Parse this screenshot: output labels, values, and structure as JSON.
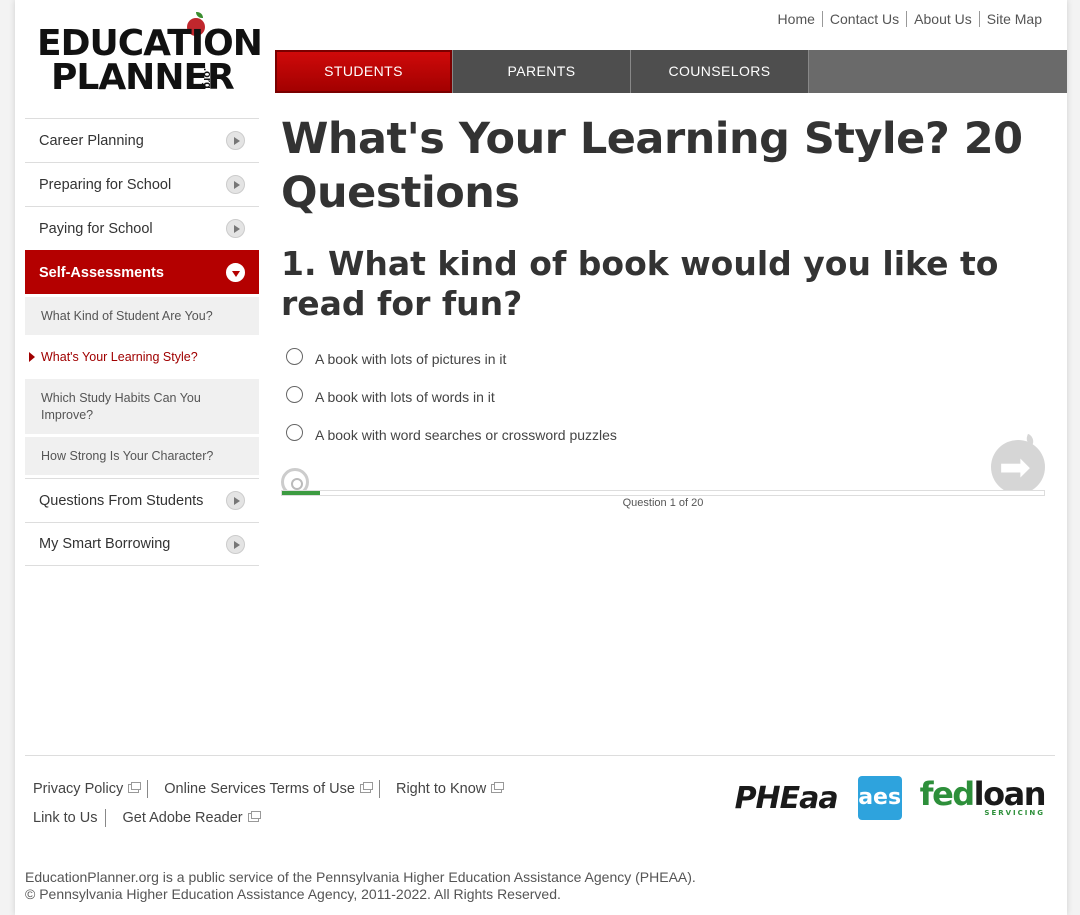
{
  "logo": {
    "line1": "EDUCATION",
    "line2": "PLANNER",
    "suffix": ".org"
  },
  "toplinks": [
    "Home",
    "Contact Us",
    "About Us",
    "Site Map"
  ],
  "tabs": [
    "STUDENTS",
    "PARENTS",
    "COUNSELORS"
  ],
  "sidebar": {
    "items": [
      {
        "label": "Career Planning"
      },
      {
        "label": "Preparing for School"
      },
      {
        "label": "Paying for School"
      },
      {
        "label": "Self-Assessments"
      },
      {
        "label": "Questions From Students"
      },
      {
        "label": "My Smart Borrowing"
      }
    ],
    "subitems": [
      {
        "label": "What Kind of Student Are You?"
      },
      {
        "label": "What's Your Learning Style?"
      },
      {
        "label": "Which Study Habits Can You Improve?"
      },
      {
        "label": "How Strong Is Your Character?"
      }
    ]
  },
  "main": {
    "title": "What's Your Learning Style? 20 Questions",
    "question": "1. What kind of book would you like to read for fun?",
    "options": [
      {
        "label": "A book with lots of pictures in it"
      },
      {
        "label": "A book with lots of words in it"
      },
      {
        "label": "A book with word searches or crossword puzzles"
      }
    ],
    "progress_fraction": 0.05,
    "question_count": "Question 1 of 20"
  },
  "footer": {
    "links": [
      "Privacy Policy",
      "Online Services Terms of Use",
      "Right to Know",
      "Link to Us",
      "Get Adobe Reader"
    ],
    "partners": {
      "pheaa": "PHEaa",
      "aes": "aes",
      "fedloan_a": "fed",
      "fedloan_b": "loan",
      "fedloan_sub": "SERVICING"
    },
    "copy1": "EducationPlanner.org is a public service of the Pennsylvania Higher Education Assistance Agency (PHEAA).",
    "copy2": "© Pennsylvania Higher Education Assistance Agency, 2011-2022. All Rights Reserved."
  },
  "colors": {
    "brand_red": "#b40000",
    "progress_green": "#3c9b41",
    "tab_dark": "#4e4e4e"
  }
}
